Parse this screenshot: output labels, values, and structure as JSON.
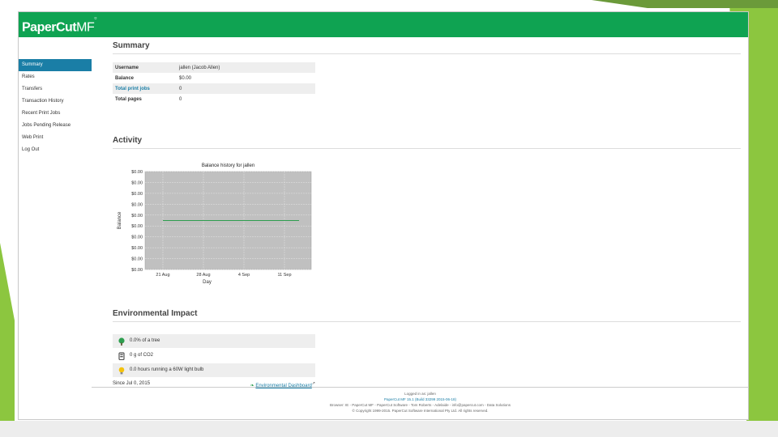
{
  "brand": {
    "name_bold": "PaperCut",
    "name_light": "MF"
  },
  "sidebar": {
    "items": [
      {
        "label": "Summary"
      },
      {
        "label": "Rates"
      },
      {
        "label": "Transfers"
      },
      {
        "label": "Transaction History"
      },
      {
        "label": "Recent Print Jobs"
      },
      {
        "label": "Jobs Pending Release"
      },
      {
        "label": "Web Print"
      },
      {
        "label": "Log Out"
      }
    ]
  },
  "summary": {
    "title": "Summary",
    "rows": [
      {
        "label": "Username",
        "value": "jallen (Jacob Allen)"
      },
      {
        "label": "Balance",
        "value": "$0.00"
      },
      {
        "label": "Total print jobs",
        "value": "0"
      },
      {
        "label": "Total pages",
        "value": "0"
      }
    ]
  },
  "activity": {
    "title": "Activity"
  },
  "chart_data": {
    "type": "line",
    "title": "Balance history for jallen",
    "xlabel": "Day",
    "ylabel": "Balance",
    "x_ticks": [
      "21 Aug",
      "28 Aug",
      "4 Sep",
      "11 Sep"
    ],
    "y_ticks": [
      "$0.00",
      "$0.00",
      "$0.00",
      "$0.00",
      "$0.00",
      "$0.00",
      "$0.00",
      "$0.00",
      "$0.00",
      "$0.00"
    ],
    "series": [
      {
        "values": [
          0,
          0
        ],
        "color": "#2e9e4f"
      }
    ],
    "grid": true
  },
  "environment": {
    "title": "Environmental Impact",
    "rows": [
      {
        "icon": "tree-icon",
        "text": "0.0% of a tree"
      },
      {
        "icon": "battery-icon",
        "text": "0 g of CO2"
      },
      {
        "icon": "bulb-icon",
        "text": "0.0 hours running a 60W light bulb"
      }
    ],
    "since": "Since Jul 0, 2015",
    "dashboard_link": "Environmental Dashboard"
  },
  "footer": {
    "line1": "Logged in as: jallen",
    "line2": "PaperCut MF 15.1 (Build 33299 2015-06-18)",
    "line3": "Browser: IE - PaperCut MF - PaperCut Software - Tom Roberts - Adelaide - info@papercut.com - Data Solutions",
    "line4": "© Copyright 1999-2015. PaperCut Software International Pty Ltd. All rights reserved."
  },
  "colors": {
    "header": "#0fa352",
    "accent": "#1a7ea6",
    "chart_bg": "#c0c0c0",
    "series": "#2e9e4f"
  }
}
